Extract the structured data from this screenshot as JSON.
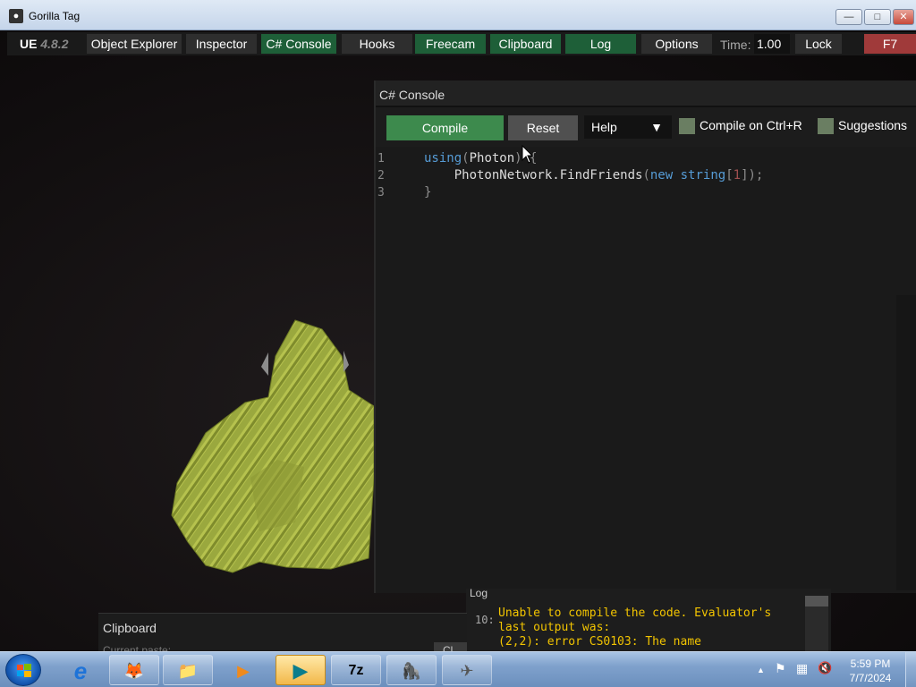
{
  "window": {
    "title": "Gorilla Tag",
    "controls": {
      "minimize": "—",
      "maximize": "□",
      "close": "✕"
    }
  },
  "toolbar": {
    "logo_text": "UE",
    "version": "4.8.2",
    "buttons": [
      {
        "label": "Object Explorer",
        "active": false
      },
      {
        "label": "Inspector",
        "active": false
      },
      {
        "label": "C# Console",
        "active": true
      },
      {
        "label": "Hooks",
        "active": false
      },
      {
        "label": "Freecam",
        "active": true
      },
      {
        "label": "Clipboard",
        "active": true
      },
      {
        "label": "Log",
        "active": true
      },
      {
        "label": "Options",
        "active": false
      }
    ],
    "time_label": "Time:",
    "time_value": "1.00",
    "lock_label": "Lock",
    "f7_label": "F7"
  },
  "console": {
    "title": "C# Console",
    "compile_label": "Compile",
    "reset_label": "Reset",
    "help_label": "Help",
    "help_arrow": "▼",
    "compile_on_ctrl_r_label": "Compile on Ctrl+R",
    "suggestions_label": "Suggestions",
    "line_numbers": [
      "1",
      "2",
      "3"
    ],
    "code": {
      "l1_kw": "using",
      "l1_open": "(",
      "l1_ident": "Photon",
      "l1_close": ") {",
      "l2_indent": "    ",
      "l2_ident": "PhotonNetwork.FindFriends",
      "l2_open": "(",
      "l2_new": "new",
      "l2_type": "string",
      "l2_bracket_open": "[",
      "l2_number": "1",
      "l2_bracket_close": "]",
      "l2_end": ");",
      "l3": "}"
    }
  },
  "log": {
    "title": "Log",
    "entry_number": "10:",
    "message": "Unable to compile the code. Evaluator's\nlast output was:\n(2,2): error CS0103: The name"
  },
  "clipboard": {
    "title": "Clipboard",
    "subtitle": "Current paste:",
    "button_label": "Cl"
  },
  "taskbar": {
    "items": [
      {
        "name": "ie",
        "glyph": "e"
      },
      {
        "name": "firefox",
        "glyph": "🦊"
      },
      {
        "name": "explorer",
        "glyph": "📁"
      },
      {
        "name": "media-player",
        "glyph": "▶"
      },
      {
        "name": "game-launcher",
        "glyph": "▶"
      },
      {
        "name": "7zip",
        "glyph": "7z"
      },
      {
        "name": "gorilla-tag",
        "glyph": "🦍"
      },
      {
        "name": "app-tool",
        "glyph": "✈"
      }
    ],
    "tray": {
      "arrow": "▲",
      "flag": "⚑",
      "network": "▦",
      "volume": "🔇"
    },
    "clock_time": "5:59 PM",
    "clock_date": "7/7/2024"
  },
  "colors": {
    "accent_green": "#3d8a4d",
    "active_tab_green": "#1e5f38",
    "f7_red": "#a03a3a",
    "log_text_yellow": "#f2c400",
    "code_keyword_blue": "#569cd6"
  }
}
